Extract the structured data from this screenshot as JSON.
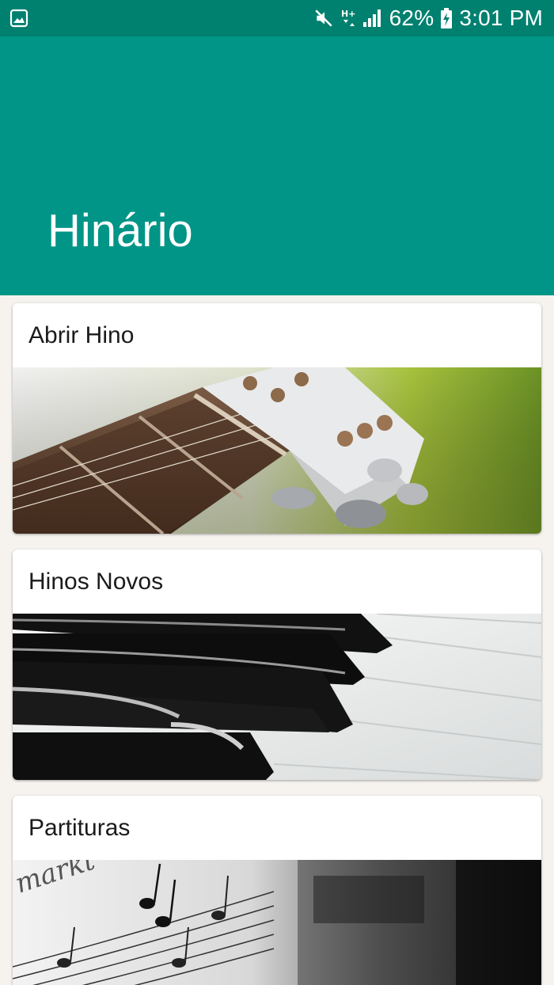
{
  "status_bar": {
    "battery": "62%",
    "time": "3:01 PM"
  },
  "app_bar": {
    "title": "Hinário"
  },
  "cards": [
    {
      "label": "Abrir Hino",
      "image": "guitar-headstock-image"
    },
    {
      "label": "Hinos Novos",
      "image": "piano-keys-image"
    },
    {
      "label": "Partituras",
      "image": "sheet-music-image"
    }
  ],
  "colors": {
    "status_bar": "#00806f",
    "app_bar": "#009587",
    "background": "#f6f3ef"
  }
}
